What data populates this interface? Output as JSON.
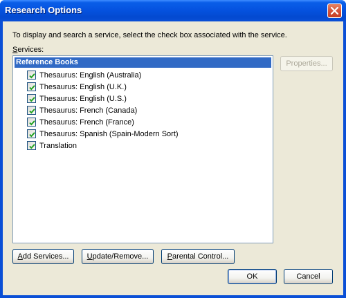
{
  "window": {
    "title": "Research Options"
  },
  "instructions": "To display and search a service, select the check box associated with the service.",
  "services": {
    "label_mnemonic": "S",
    "label_rest": "ervices:",
    "group_header": "Reference Books",
    "items": [
      {
        "label": "Thesaurus: English (Australia)",
        "checked": true
      },
      {
        "label": "Thesaurus: English (U.K.)",
        "checked": true
      },
      {
        "label": "Thesaurus: English (U.S.)",
        "checked": true
      },
      {
        "label": "Thesaurus: French (Canada)",
        "checked": true
      },
      {
        "label": "Thesaurus: French (France)",
        "checked": true
      },
      {
        "label": "Thesaurus: Spanish (Spain-Modern Sort)",
        "checked": true
      },
      {
        "label": "Translation",
        "checked": true
      }
    ]
  },
  "buttons": {
    "properties": {
      "mnemonic": "",
      "rest": "Properties..."
    },
    "add_services": {
      "mnemonic": "A",
      "rest": "dd Services..."
    },
    "update_remove": {
      "mnemonic": "U",
      "rest": "pdate/Remove..."
    },
    "parental_control": {
      "mnemonic": "P",
      "rest": "arental Control..."
    },
    "ok": "OK",
    "cancel": "Cancel"
  },
  "colors": {
    "title_bar": "#0553e0",
    "selection": "#316ac5",
    "dialog_bg": "#ece9d8",
    "check_mark": "#21a121"
  },
  "icons": {
    "close": "close-icon",
    "check": "check-icon"
  }
}
